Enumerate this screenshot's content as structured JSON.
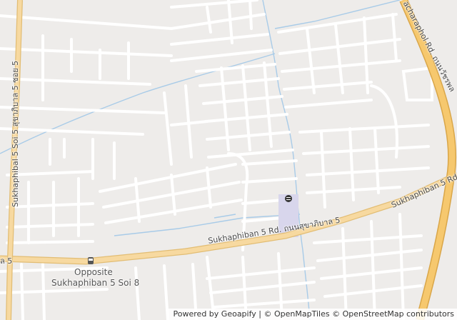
{
  "map": {
    "roads": {
      "main_road_label": "Sukhaphiban 5 Rd. ถนนสุขาภิบาล 5",
      "left_road_label": "Sukhaphibal 5 Soi 5 สุขาภิบาล 5 ซอย 5",
      "right_road_label": "Phahonyothin / Vacharaphol Rd. ถนนวัชรพล",
      "right_road_visible_label": "acharaphol Rd. ถนนวัชรพล",
      "right_road_lower_label": "Sukhaphiban 5 Rd",
      "left_edge_label": "ล 5"
    },
    "bus_stop": {
      "name_line1": "Opposite",
      "name_line2": "Sukhaphiban 5 Soi 8",
      "icon": "bus-stop-icon"
    },
    "poi_icon": "place-of-worship-icon",
    "colors": {
      "background": "#eeecea",
      "minor_road": "#ffffff",
      "main_road_fill": "#f7d9a0",
      "main_road_casing": "#e2bd74",
      "expressway_fill": "#f6c86e",
      "expressway_casing": "#d9a649",
      "water": "#a8cbe8",
      "poi_area": "#d8d6ec"
    }
  },
  "attribution": {
    "powered_by": "Powered by",
    "geoapify": "Geoapify",
    "separator1": " | ",
    "omt": "© OpenMapTiles",
    "separator2": " ",
    "osm": "© OpenStreetMap",
    "contributors": " contributors"
  }
}
